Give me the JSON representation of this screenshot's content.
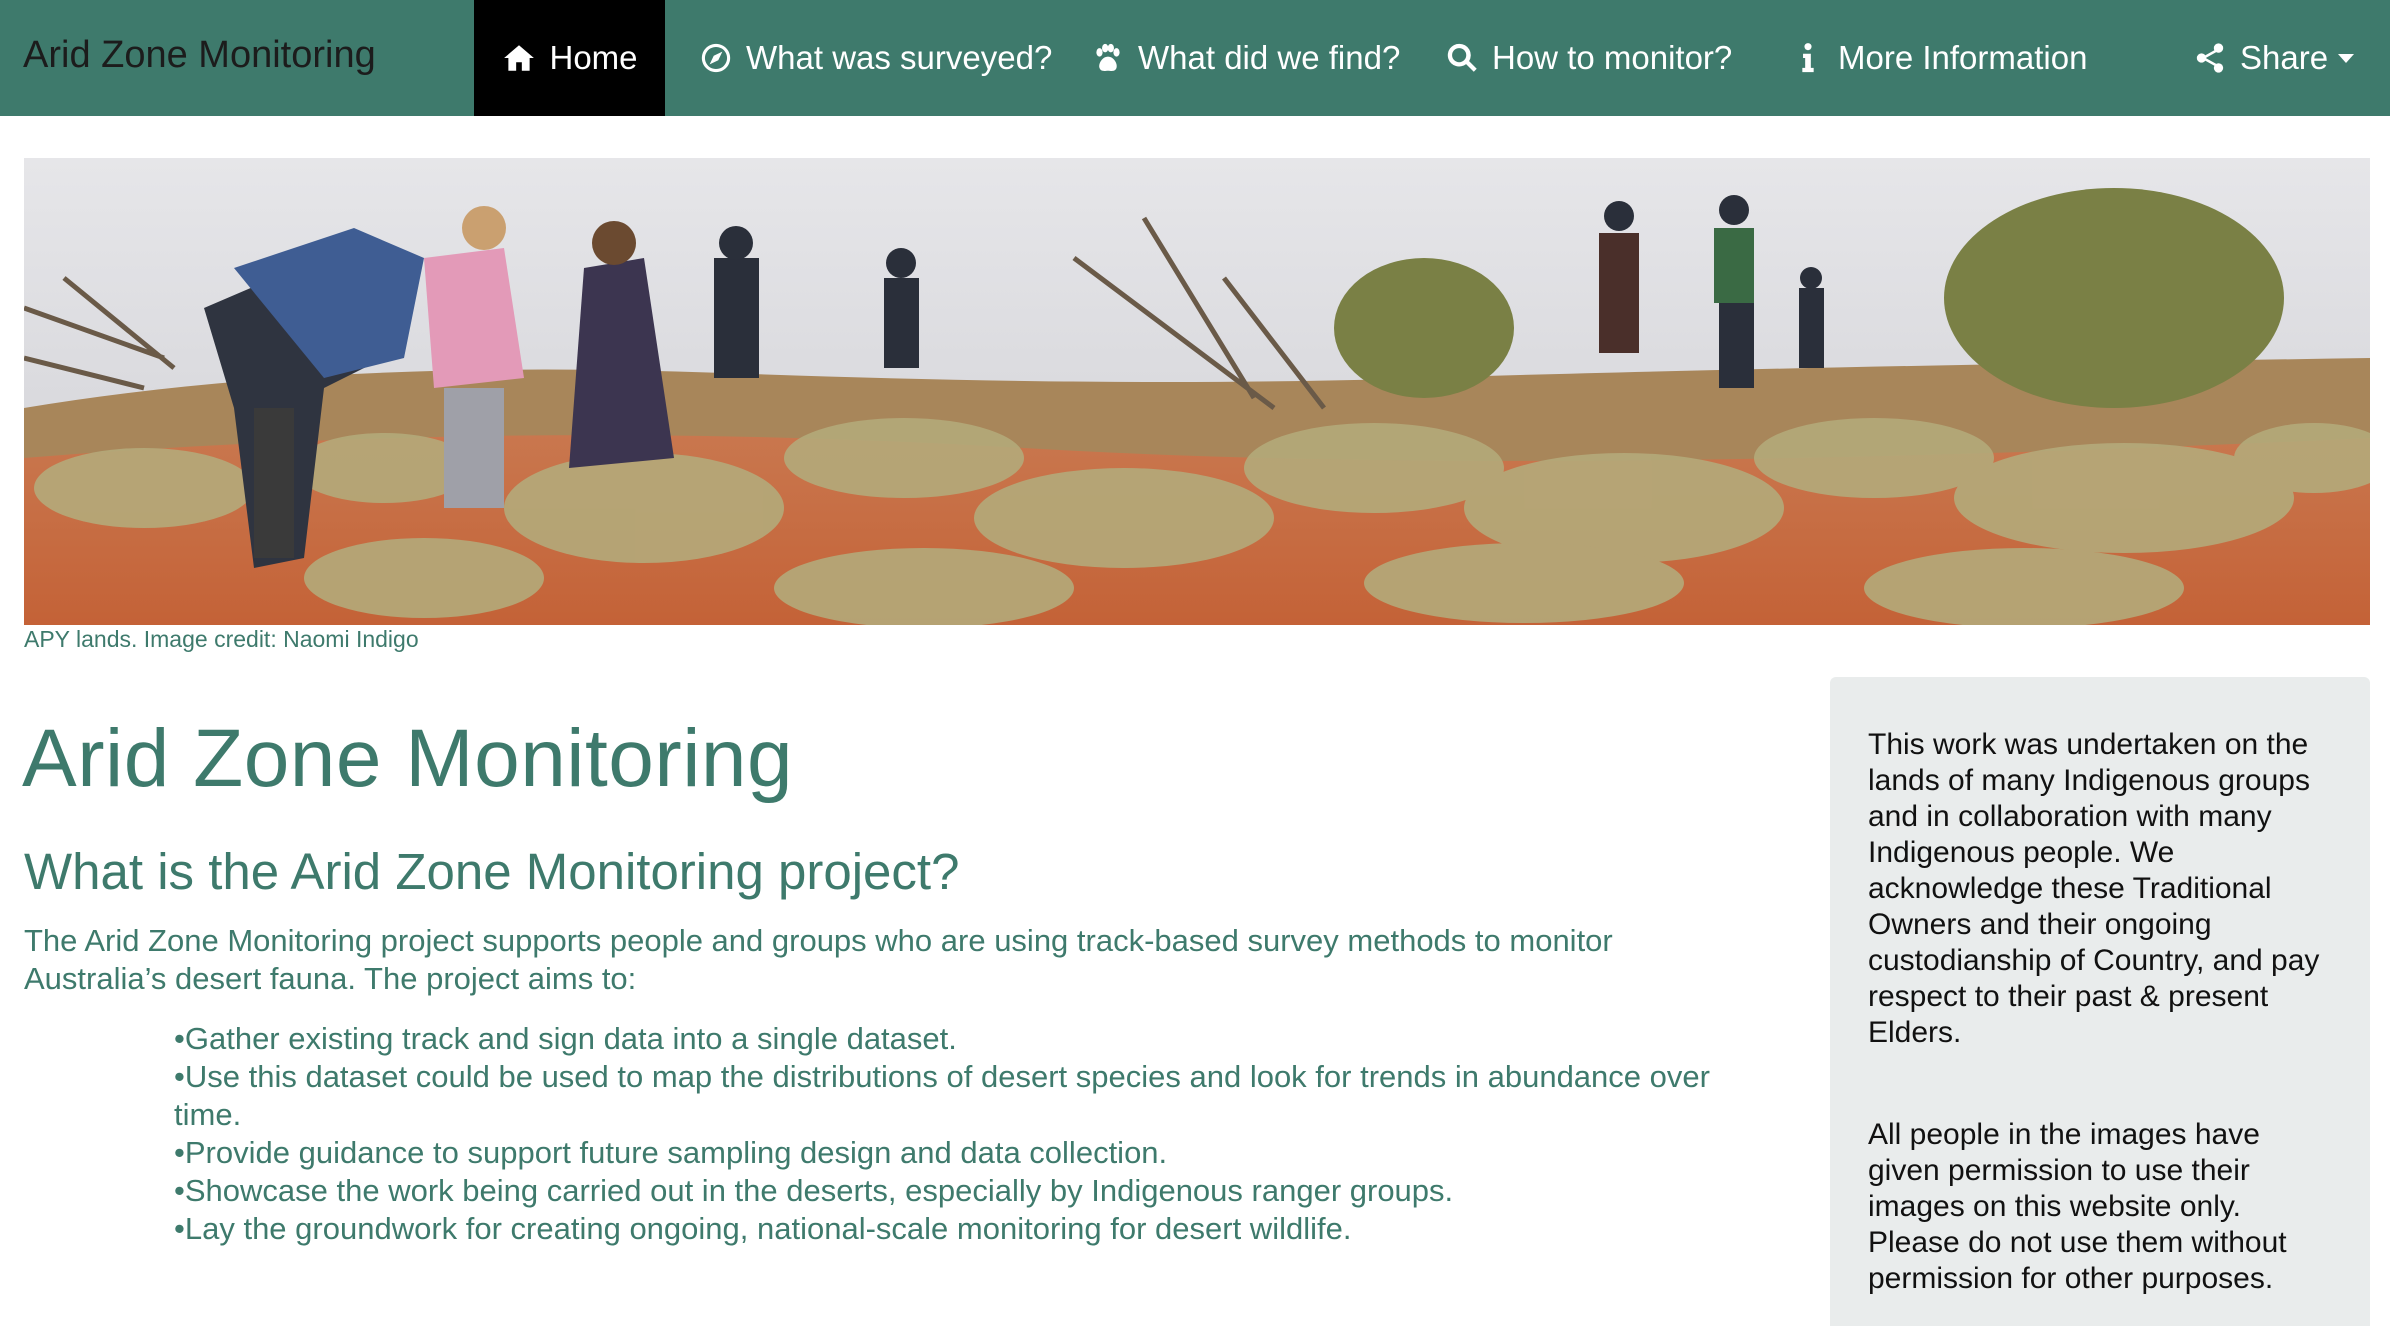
{
  "nav": {
    "brand": "Arid Zone Monitoring",
    "items": [
      {
        "label": "Home",
        "icon": "home-icon",
        "active": true
      },
      {
        "label": "What was surveyed?",
        "icon": "compass-icon"
      },
      {
        "label": "What did we find?",
        "icon": "paw-icon"
      },
      {
        "label": "How to monitor?",
        "icon": "search-icon"
      },
      {
        "label": "More Information",
        "icon": "info-icon"
      },
      {
        "label": "Share",
        "icon": "share-icon"
      }
    ],
    "colors": {
      "bar": "#3e7a6c",
      "active": "#000000"
    }
  },
  "banner": {
    "caption": "APY lands. Image credit: Naomi Indigo"
  },
  "main": {
    "title": "Arid Zone Monitoring",
    "subtitle": "What is the Arid Zone Monitoring project?",
    "intro": "The Arid Zone Monitoring project supports people and groups who are using track-based survey methods to monitor Australia’s desert fauna. The project aims to:",
    "aims": [
      "Gather existing track and sign data into a single dataset.",
      "Use this dataset could be used to map the distributions of desert species and look for trends in abundance over time.",
      "Provide guidance to support future sampling design and data collection.",
      "Showcase the work being carried out in the deserts, especially by Indigenous ranger groups.",
      "Lay the groundwork for creating ongoing, national-scale monitoring for desert wildlife."
    ]
  },
  "sidebar": {
    "acknowledgement": "This work was undertaken on the lands of many Indigenous groups and in collaboration with many Indigenous people. We acknowledge these Traditional Owners and their ongoing custodianship of Country, and pay respect to their past & present Elders.",
    "permission": "All people in the images have given permission to use their images on this website only. Please do not use them without permission for other purposes."
  }
}
